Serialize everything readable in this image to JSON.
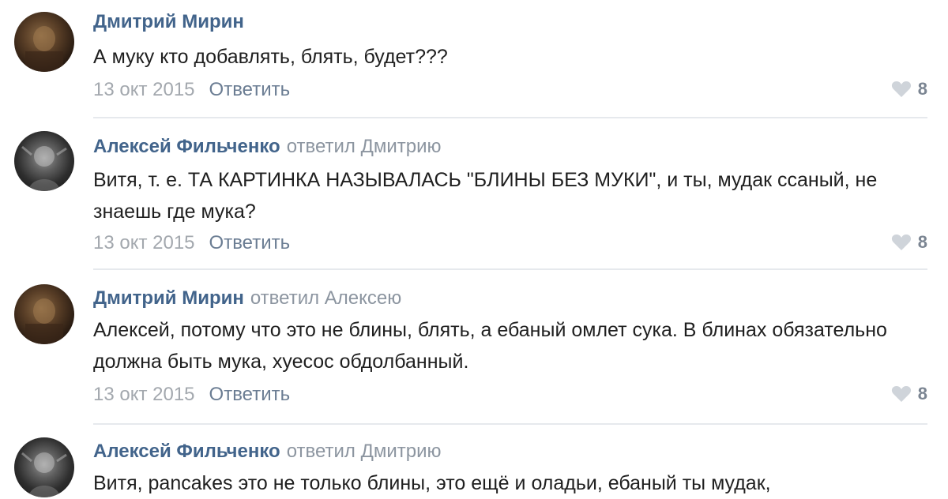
{
  "comments": [
    {
      "author": "Дмитрий Мирин",
      "reply_to": "",
      "text": "А муку кто добавлять, блять, будет???",
      "date": "13 окт 2015",
      "reply_label": "Ответить",
      "likes": "8",
      "avatar_icon": "avatar-photo-icon"
    },
    {
      "author": "Алексей Фильченко",
      "reply_to": "ответил Дмитрию",
      "text": "Витя, т. е. ТА КАРТИНКА НАЗЫВАЛАСЬ \"БЛИНЫ БЕЗ МУКИ\", и ты, мудак ссаный, не знаешь где мука?",
      "date": "13 окт 2015",
      "reply_label": "Ответить",
      "likes": "8",
      "avatar_icon": "avatar-photo-icon"
    },
    {
      "author": "Дмитрий Мирин",
      "reply_to": "ответил Алексею",
      "text": "Алексей, потому что это не блины, блять, а ебаный омлет сука. В блинах обязательно должна быть мука, хуесос обдолбанный.",
      "date": "13 окт 2015",
      "reply_label": "Ответить",
      "likes": "8",
      "avatar_icon": "avatar-photo-icon"
    },
    {
      "author": "Алексей Фильченко",
      "reply_to": "ответил Дмитрию",
      "text": "Витя, pancakes это не только блины, это ещё и оладьи, ебаный ты мудак,",
      "date": "",
      "reply_label": "",
      "likes": "",
      "avatar_icon": "avatar-photo-icon"
    }
  ],
  "icons": {
    "like": "heart-icon"
  },
  "colors": {
    "author": "#42648b",
    "secondary": "#8c95a0",
    "text": "#1f1f1f",
    "divider": "#e6e9ed"
  }
}
